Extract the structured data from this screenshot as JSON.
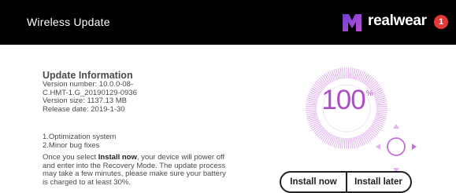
{
  "header": {
    "title": "Wireless Update",
    "brand": "realwear",
    "notification_count": "1"
  },
  "info": {
    "heading": "Update Information",
    "version_number": "Version number: 10.0.0-08-",
    "version_number_cont": "C.HMT-1.G_20190129-0936",
    "version_size": "Version size: 1137.13 MB",
    "release_date": "Release date: 2019-1-30"
  },
  "notes": {
    "item1": "1.Optimization system",
    "item2": "2.Minor bug fixes"
  },
  "notice": {
    "part1": "Once you select ",
    "emphasis": "Install now",
    "part2": ", your device will power off and enter into the Recovery Mode. The update process may take a few minutes, please make sure your battery is charged to at least 30%."
  },
  "progress": {
    "value": "100",
    "unit": "%",
    "fraction": 1.0
  },
  "actions": {
    "install_now": "Install now",
    "install_later": "Install later"
  },
  "colors": {
    "accent": "#b04cc8",
    "accent_light": "#e3b5ef",
    "header_bg": "#000000",
    "badge": "#e53935"
  },
  "icons": {
    "logo": "realwear-logo-icon",
    "dpad": "navigation-dpad-icon"
  }
}
